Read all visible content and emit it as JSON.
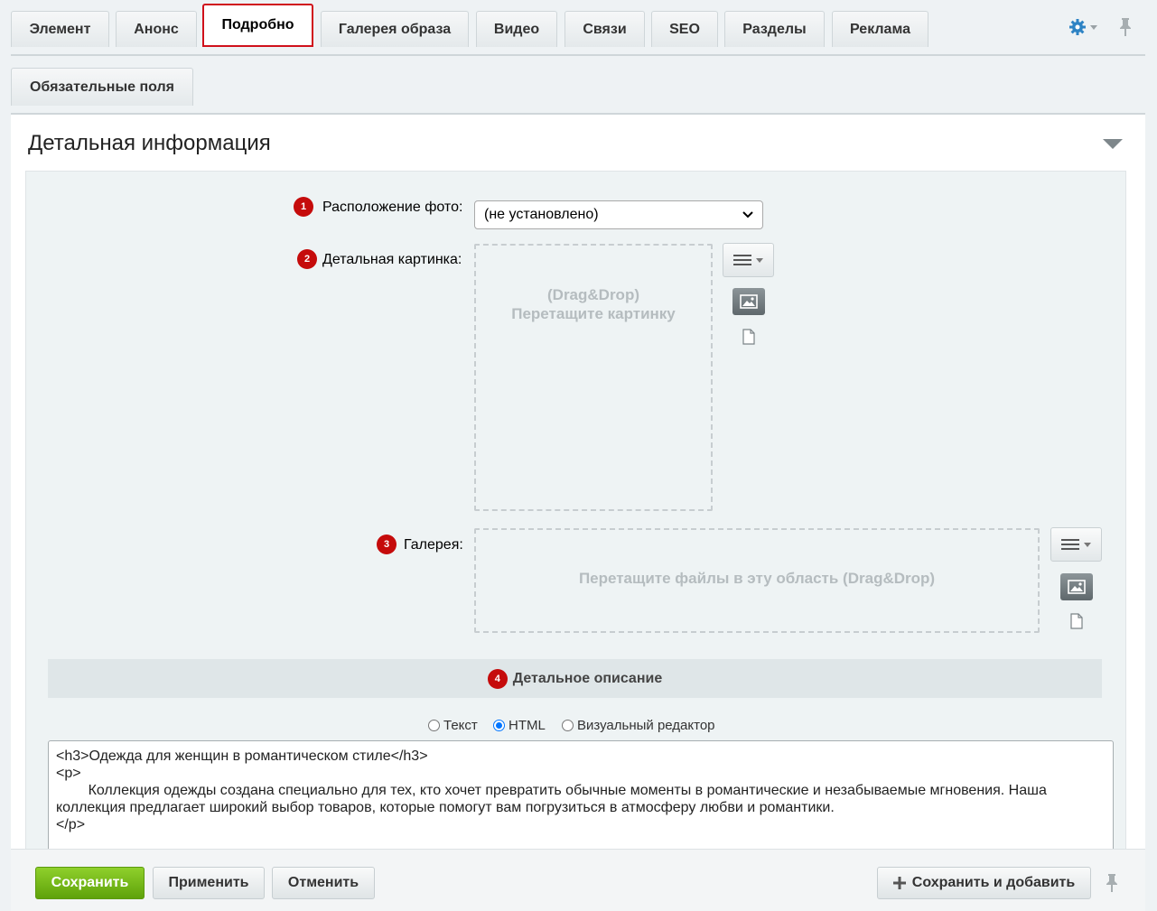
{
  "tabs": [
    {
      "label": "Элемент"
    },
    {
      "label": "Анонс"
    },
    {
      "label": "Подробно",
      "active": true
    },
    {
      "label": "Галерея образа"
    },
    {
      "label": "Видео"
    },
    {
      "label": "Связи"
    },
    {
      "label": "SEO"
    },
    {
      "label": "Разделы"
    },
    {
      "label": "Реклама"
    }
  ],
  "subtabs": [
    {
      "label": "Обязательные поля"
    }
  ],
  "panel": {
    "title": "Детальная информация"
  },
  "fields": {
    "photo_position": {
      "marker": "1",
      "label": "Расположение фото:",
      "value": "(не установлено)"
    },
    "detail_picture": {
      "marker": "2",
      "label": "Детальная картинка:",
      "drop_line1": "(Drag&Drop)",
      "drop_line2": "Перетащите картинку"
    },
    "gallery": {
      "marker": "3",
      "label": "Галерея:",
      "drop_text": "Перетащите файлы в эту область (Drag&Drop)"
    }
  },
  "description": {
    "marker": "4",
    "title": "Детальное описание",
    "modes": [
      "Текст",
      "HTML",
      "Визуальный редактор"
    ],
    "selected_mode": "HTML",
    "content": "<h3>Одежда для женщин в романтическом стиле</h3>\n<p>\n\tКоллекция одежды создана специально для тех, кто хочет превратить обычные моменты в романтические и незабываемые мгновения. Наша коллекция предлагает широкий выбор товаров, которые помогут вам погрузиться в атмосферу любви и романтики.\n</p>"
  },
  "footer": {
    "save": "Сохранить",
    "apply": "Применить",
    "cancel": "Отменить",
    "save_and_add": "Сохранить и добавить"
  },
  "colors": {
    "accent_green": "#6cb515",
    "marker_red": "#c50b0b",
    "active_tab_border": "#d0111b"
  }
}
